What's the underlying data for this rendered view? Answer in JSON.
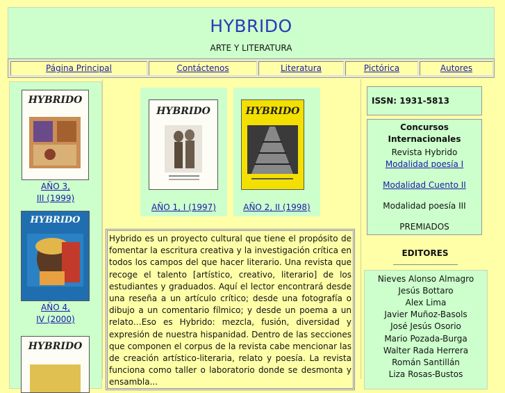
{
  "header": {
    "title": "HYBRIDO",
    "subtitle": "ARTE Y LITERATURA"
  },
  "nav": [
    {
      "label": "Página Principal"
    },
    {
      "label": "Contáctenos"
    },
    {
      "label": "Literatura"
    },
    {
      "label": "Pictórica"
    },
    {
      "label": "Autores"
    }
  ],
  "covers": {
    "title": "HYBRIDO"
  },
  "left_issues": [
    {
      "line1": "AÑO 3,",
      "line2": "III (1999)"
    },
    {
      "line1": "AÑO 4,",
      "line2": "IV (2000)"
    }
  ],
  "mid_issues": [
    {
      "label": "AÑO 1, I (1997)"
    },
    {
      "label": "AÑO 2, II (1998)"
    }
  ],
  "article": {
    "text": "Hybrido es un proyecto cultural que tiene el propósito de fomentar la escritura creativa y la investigación crítica en todos los campos del que hacer literario. Una revista que recoge el talento [artístico, creativo, literario] de los estudiantes y graduados. Aquí el lector encontrará desde una reseña a un artículo crítico; desde una fotografía o dibujo a un comentario fílmico; y desde un poema a un relato…Eso es Hybrido: mezcla, fusión, diversidad y expresión de nuestra hispanidad. Dentro de las secciones que componen el corpus de la revista cabe mencionar las de creación artístico-literaria, relato y poesía. La revista funciona como taller o laboratorio donde se desmonta y ensambla..."
  },
  "issn": "ISSN: 1931-5813",
  "concursos": {
    "title1": "Concursos",
    "title2": "Internacionales",
    "revista": "Revista Hybrido",
    "poesia1": "Modalidad poesía I",
    "cuento2": "Modalidad Cuento II",
    "poesia3": "Modalidad poesía III",
    "premiados": "PREMIADOS"
  },
  "editores": {
    "title": "EDITORES",
    "names": [
      "Nieves Alonso Almagro",
      "Jesús Bottaro",
      "Alex Lima",
      "Javier Muñoz-Basols",
      "José Jesús Osorio",
      "Mario Pozada-Burga",
      "Walter Rada Herrera",
      "Román Santillán",
      "Liza Rosas-Bustos"
    ]
  },
  "colors": {
    "background": "#ffffa8",
    "panel": "#ccffcc",
    "link": "#1a1aaa",
    "title": "#2b39b8"
  }
}
